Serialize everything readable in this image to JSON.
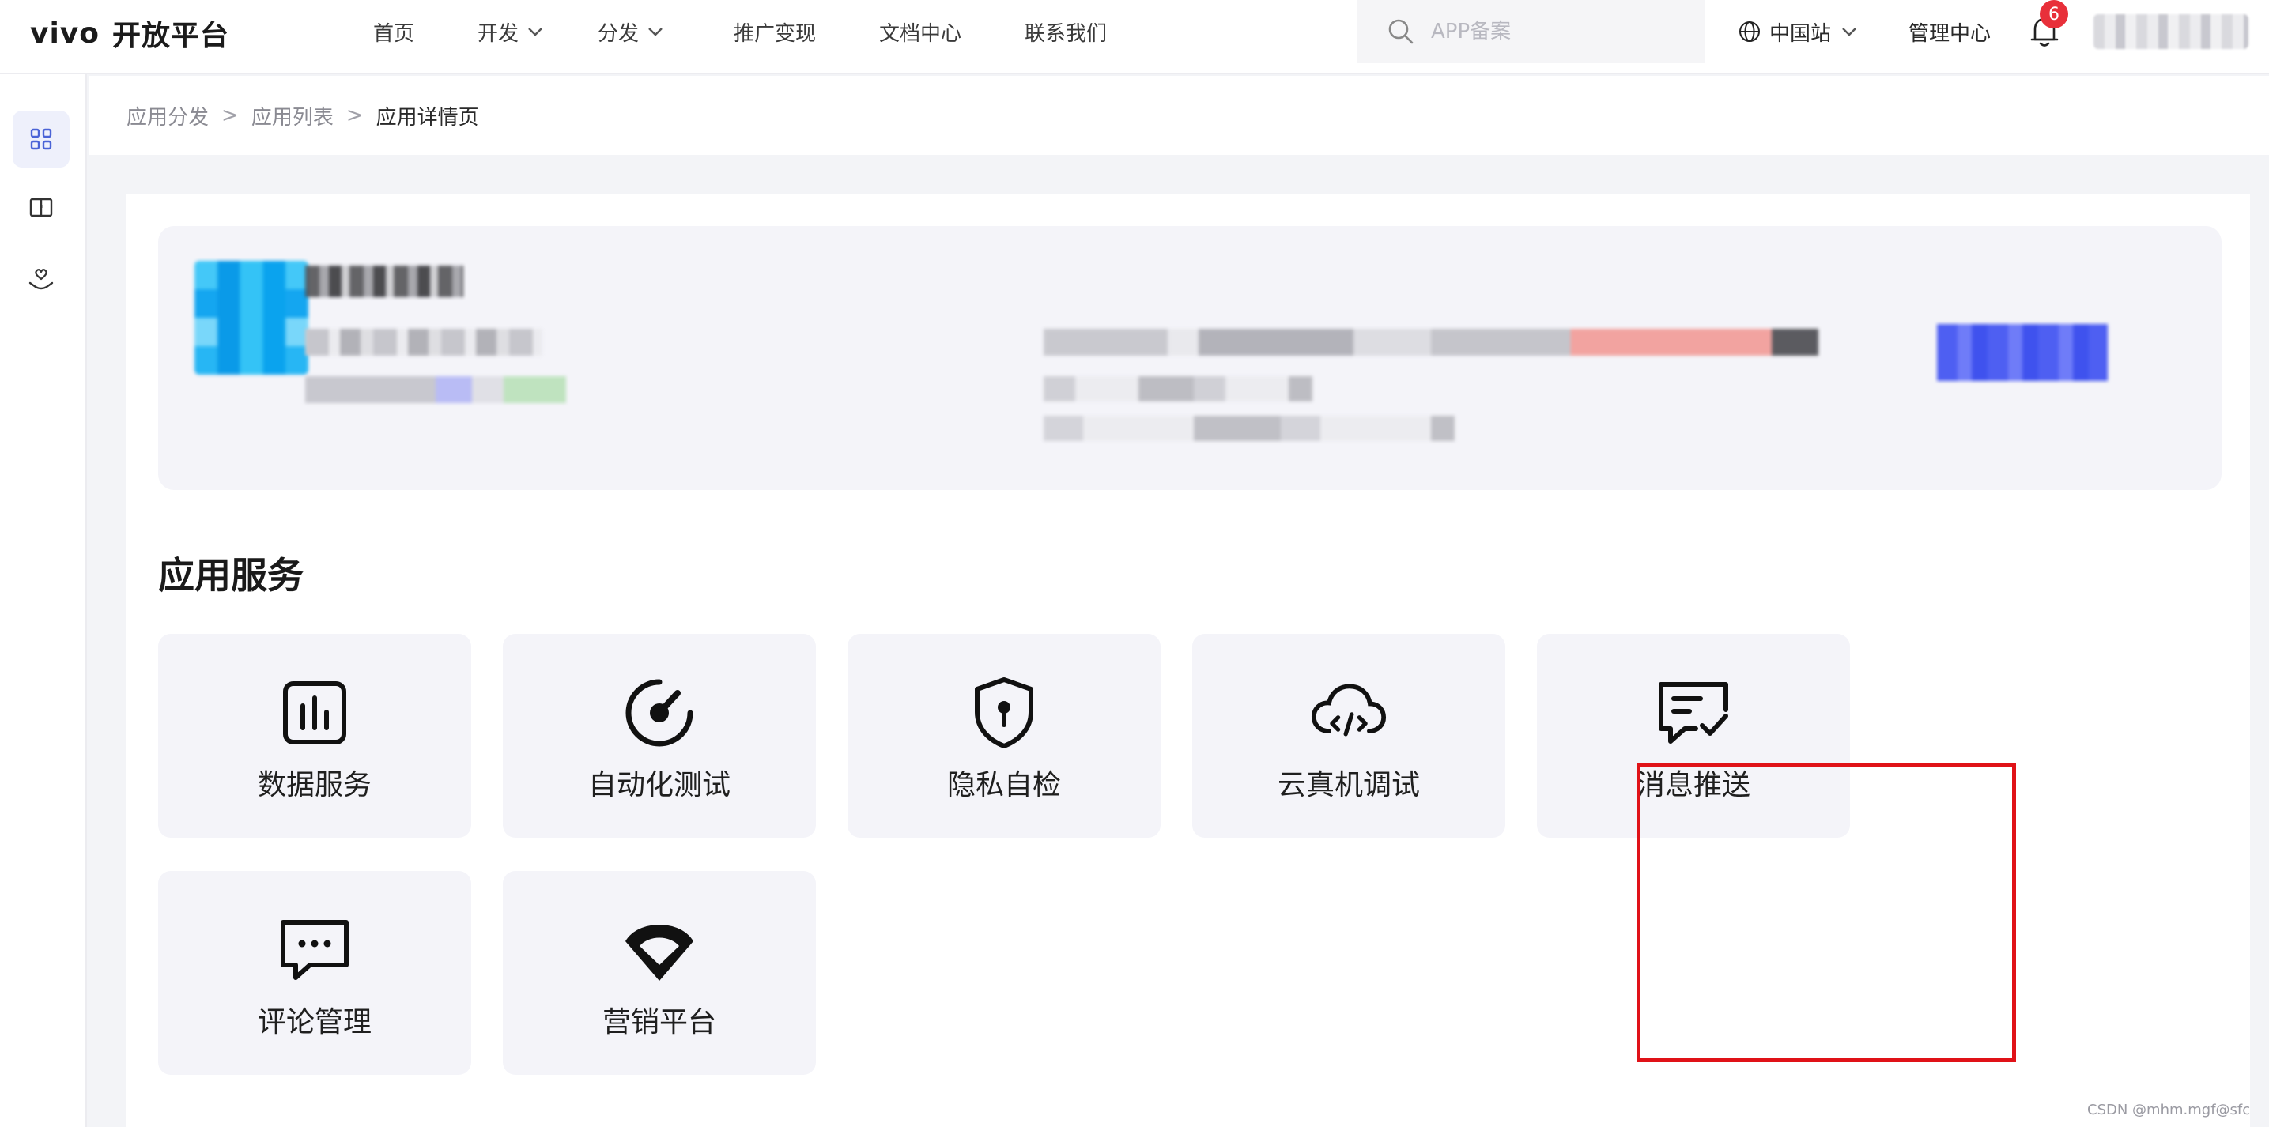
{
  "header": {
    "logo_brand": "vivo",
    "logo_text": "开放平台",
    "nav": [
      {
        "label": "首页",
        "dropdown": false
      },
      {
        "label": "开发",
        "dropdown": true
      },
      {
        "label": "分发",
        "dropdown": true
      },
      {
        "label": "推广变现",
        "dropdown": false
      },
      {
        "label": "文档中心",
        "dropdown": false
      },
      {
        "label": "联系我们",
        "dropdown": false
      }
    ],
    "search_placeholder": "APP备案",
    "region": "中国站",
    "management": "管理中心",
    "notification_count": "6"
  },
  "sidebar": {
    "items": [
      {
        "icon": "grid-icon",
        "active": true
      },
      {
        "icon": "book-icon",
        "active": false
      },
      {
        "icon": "heart-hand-icon",
        "active": false
      }
    ]
  },
  "breadcrumb": [
    "应用分发",
    "应用列表",
    "应用详情页"
  ],
  "breadcrumb_sep": ">",
  "services": {
    "title": "应用服务",
    "items": [
      {
        "label": "数据服务",
        "icon": "data-chart-icon"
      },
      {
        "label": "自动化测试",
        "icon": "gauge-icon"
      },
      {
        "label": "隐私自检",
        "icon": "shield-lock-icon"
      },
      {
        "label": "云真机调试",
        "icon": "cloud-code-icon"
      },
      {
        "label": "消息推送",
        "icon": "message-check-icon",
        "highlighted": true
      },
      {
        "label": "评论管理",
        "icon": "comment-icon"
      },
      {
        "label": "营销平台",
        "icon": "marketing-logo-icon"
      }
    ]
  },
  "watermark": "CSDN @mhm.mgf@sfc",
  "colors": {
    "accent": "#4a63d6",
    "highlight_border": "#e01218",
    "badge": "#e8303a"
  }
}
